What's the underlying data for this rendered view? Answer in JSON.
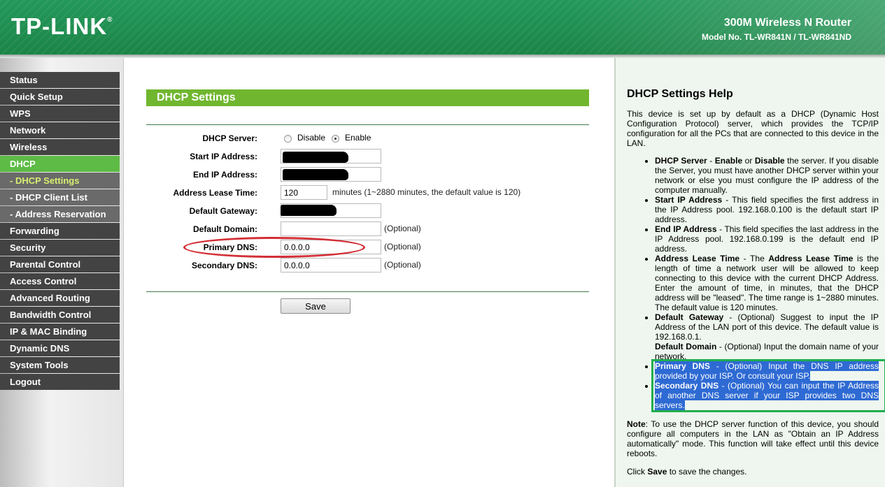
{
  "header": {
    "logo_text": "TP-LINK",
    "logo_reg": "®",
    "product_name": "300M Wireless N Router",
    "model_no": "Model No. TL-WR841N / TL-WR841ND"
  },
  "sidebar": {
    "items": [
      {
        "label": "Status"
      },
      {
        "label": "Quick Setup"
      },
      {
        "label": "WPS"
      },
      {
        "label": "Network"
      },
      {
        "label": "Wireless"
      },
      {
        "label": "DHCP"
      },
      {
        "label": "- DHCP Settings"
      },
      {
        "label": "- DHCP Client List"
      },
      {
        "label": "- Address Reservation"
      },
      {
        "label": "Forwarding"
      },
      {
        "label": "Security"
      },
      {
        "label": "Parental Control"
      },
      {
        "label": "Access Control"
      },
      {
        "label": "Advanced Routing"
      },
      {
        "label": "Bandwidth Control"
      },
      {
        "label": "IP & MAC Binding"
      },
      {
        "label": "Dynamic DNS"
      },
      {
        "label": "System Tools"
      },
      {
        "label": "Logout"
      }
    ]
  },
  "form": {
    "title": "DHCP Settings",
    "dhcp_server_label": "DHCP Server:",
    "disable_label": "Disable",
    "enable_label": "Enable",
    "dhcp_server_value": "Enable",
    "start_ip_label": "Start IP Address:",
    "end_ip_label": "End IP Address:",
    "lease_label": "Address Lease Time:",
    "lease_value": "120",
    "lease_hint": "minutes (1~2880 minutes, the default value is 120)",
    "gateway_label": "Default Gateway:",
    "domain_label": "Default Domain:",
    "domain_value": "",
    "primary_dns_label": "Primary DNS:",
    "primary_dns_value": "0.0.0.0",
    "secondary_dns_label": "Secondary DNS:",
    "secondary_dns_value": "0.0.0.0",
    "optional_hint": "(Optional)",
    "save_label": "Save"
  },
  "help": {
    "title": "DHCP Settings Help",
    "intro": "This device is set up by default as a DHCP (Dynamic Host Configuration Protocol) server, which provides the TCP/IP configuration for all the PCs that are connected to this device in the LAN.",
    "items": [
      {
        "term": "DHCP Server",
        "text_a": " - ",
        "term_b": "Enable",
        "text_b": " or ",
        "term_c": "Disable",
        "text_c": " the server. If you disable the Server, you must have another DHCP server within your network or else you must configure the IP address of the computer manually."
      },
      {
        "term": "Start IP Address",
        "text": " - This field specifies the first address in the IP Address pool. 192.168.0.100 is the default start IP address."
      },
      {
        "term": "End IP Address",
        "text": " - This field specifies the last address in the IP Address pool. 192.168.0.199 is the default end IP address."
      },
      {
        "term": "Address Lease Time",
        "text_a": " - The ",
        "term_b": "Address Lease Time",
        "text": " is the length of time a network user will be allowed to keep connecting to this device with the current DHCP Address. Enter the amount of time, in minutes, that the DHCP address will be \"leased\". The time range is 1~2880 minutes. The default value is 120 minutes."
      },
      {
        "term": "Default Gateway",
        "text": " - (Optional) Suggest to input the IP Address of the LAN port of this device. The default value is 192.168.0.1."
      },
      {
        "term": "Default Domain",
        "text": " - (Optional) Input the domain name of your network."
      },
      {
        "term": "Primary DNS",
        "text": " - (Optional) Input the DNS IP address provided by your ISP. Or consult your ISP."
      },
      {
        "term": "Secondary DNS",
        "text": " - (Optional) You can input the IP Address of another DNS server if your ISP provides two DNS servers."
      }
    ],
    "note_term": "Note",
    "note_text": ": To use the DHCP server function of this device, you should configure all computers in the LAN as \"Obtain an IP Address automatically\" mode. This function will take effect until this device reboots.",
    "click_text_a": "Click ",
    "click_term": "Save",
    "click_text_b": " to save the changes."
  }
}
